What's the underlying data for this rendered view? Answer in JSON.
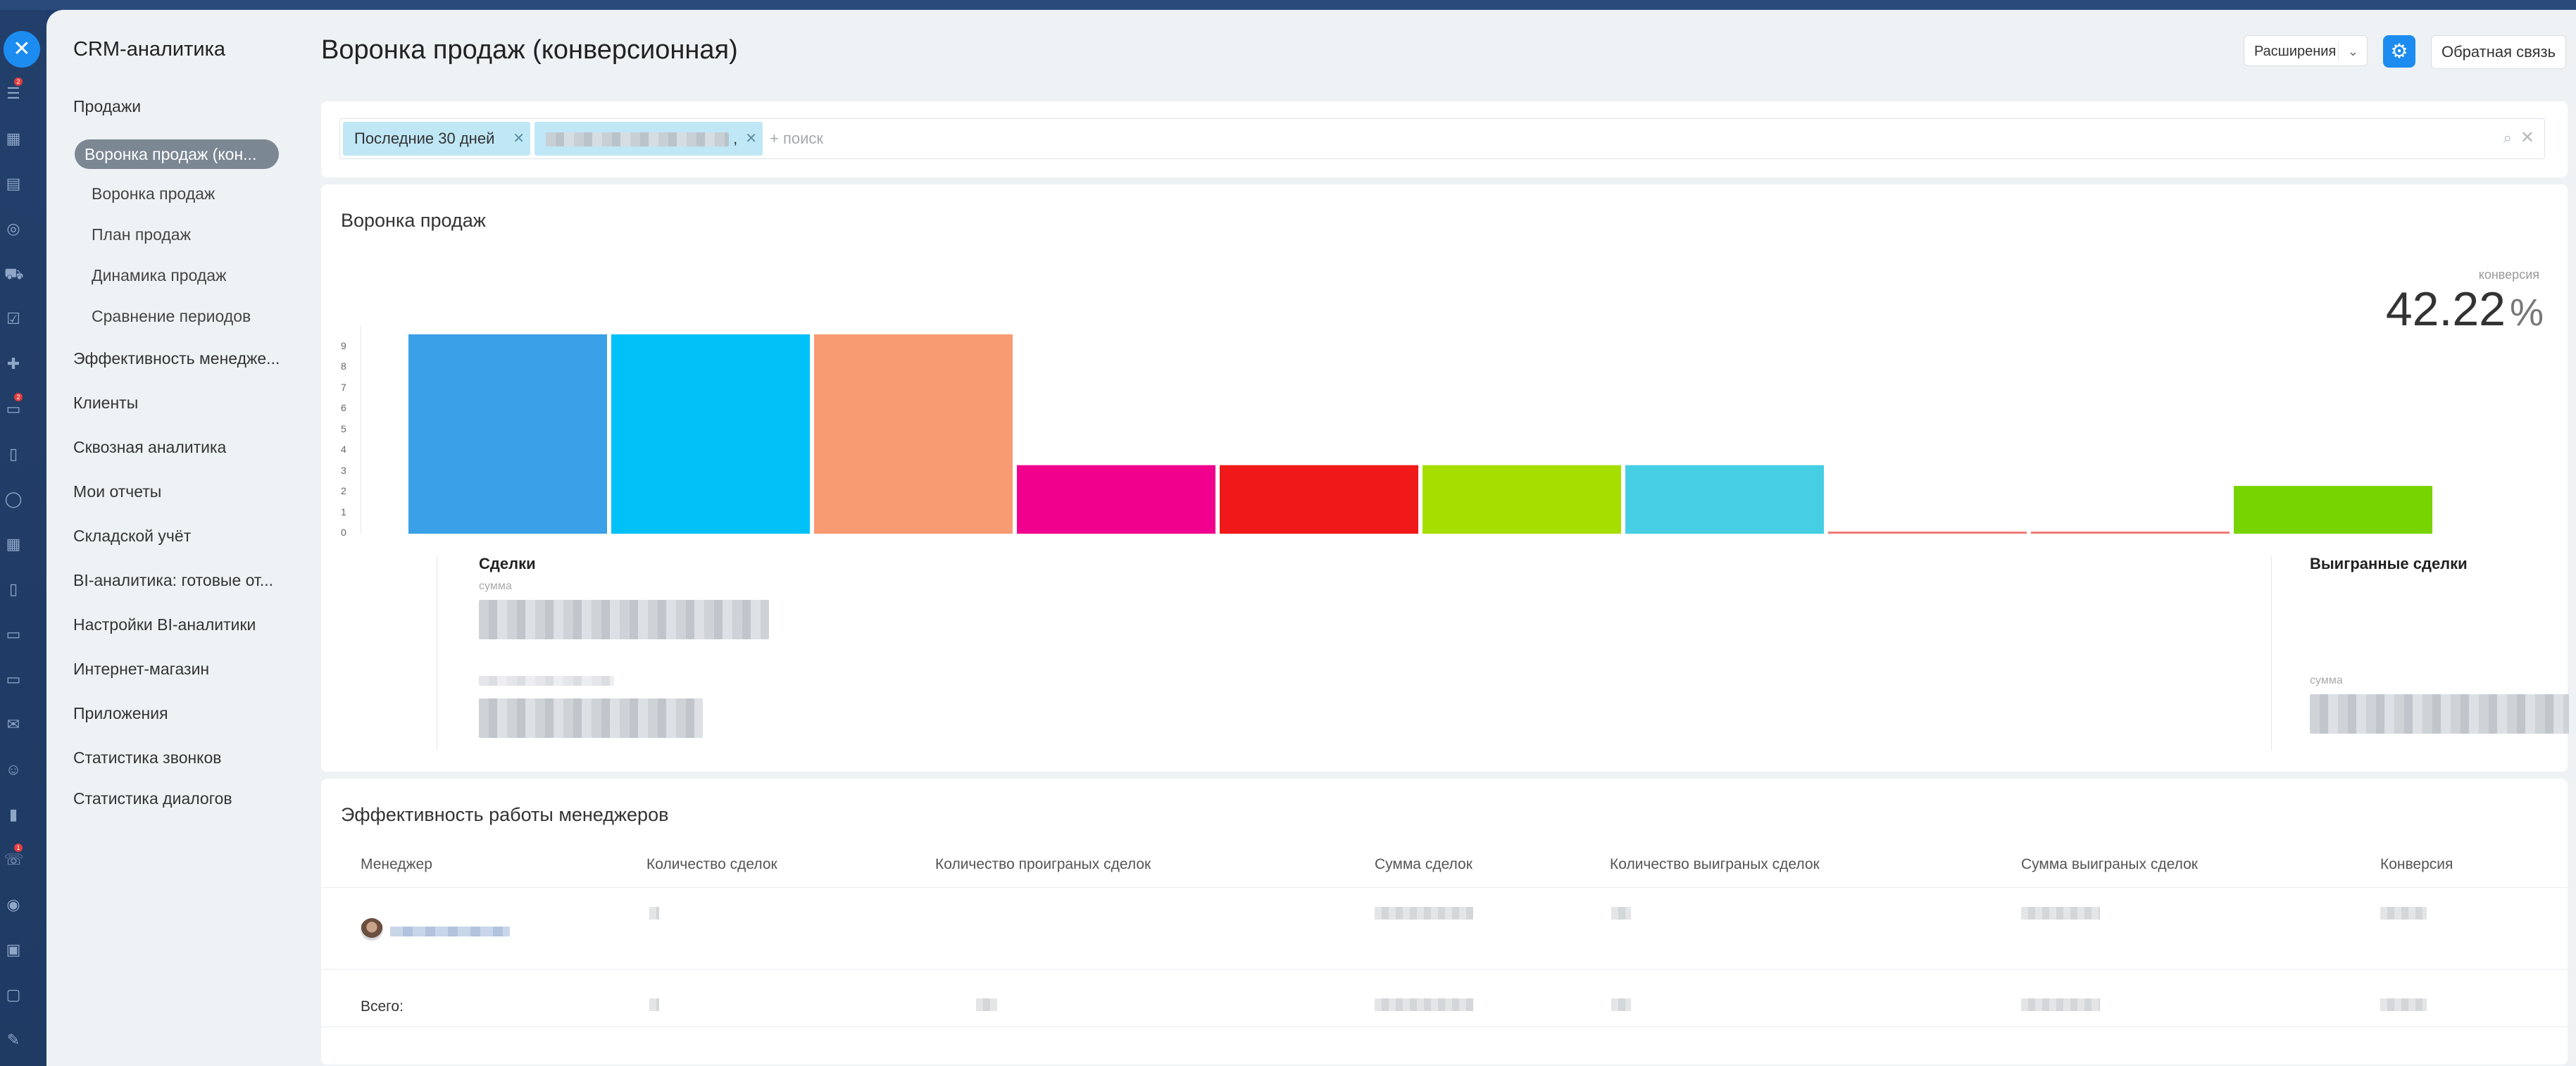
{
  "rail": {
    "icons": [
      "filter-icon",
      "calendar-icon",
      "inbox-icon",
      "target-icon",
      "cart-icon",
      "checklist-icon",
      "puzzle-icon",
      "chat-icon",
      "document-icon",
      "circle-icon",
      "calendar2-icon",
      "note-icon",
      "monitor-icon",
      "card-icon",
      "mail-icon",
      "contacts-icon",
      "analytics-icon",
      "telephony-icon",
      "robot-icon",
      "box-icon",
      "market-icon",
      "sign-icon"
    ],
    "badges": {
      "filter": "2",
      "chat": "2",
      "telephony": "1"
    }
  },
  "sidebar": {
    "title": "CRM-аналитика",
    "items": [
      {
        "label": "Продажи"
      },
      {
        "label": "Воронка продаж (кон...",
        "active": true
      },
      {
        "label": "Воронка продаж",
        "sub": true
      },
      {
        "label": "План продаж",
        "sub": true
      },
      {
        "label": "Динамика продаж",
        "sub": true
      },
      {
        "label": "Сравнение периодов",
        "sub": true
      },
      {
        "label": "Эффективность менедже..."
      },
      {
        "label": "Клиенты"
      },
      {
        "label": "Сквозная аналитика"
      },
      {
        "label": "Мои отчеты"
      },
      {
        "label": "Складской учёт"
      },
      {
        "label": "BI-аналитика: готовые от..."
      },
      {
        "label": "Настройки BI-аналитики"
      },
      {
        "label": "Интернет-магазин"
      },
      {
        "label": "Приложения"
      },
      {
        "label": "Статистика звонков"
      },
      {
        "label": "Статистика диалогов"
      }
    ]
  },
  "header": {
    "title": "Воронка продаж (конверсионная)",
    "extensions_label": "Расширения",
    "feedback_label": "Обратная связь"
  },
  "filter": {
    "chip_period": "Последние 30 дней",
    "chip_tail": ",",
    "placeholder": "+ поиск"
  },
  "funnel": {
    "title": "Воронка продаж",
    "conversion_label": "конверсия",
    "conversion_value": "42.22",
    "conversion_unit": "%",
    "deals_title": "Сделки",
    "deals_sum_label": "сумма",
    "won_title": "Выигранные сделки",
    "won_sum_label": "сумма"
  },
  "chart_data": {
    "type": "bar",
    "y_ticks": [
      "0",
      "1",
      "2",
      "3",
      "4",
      "5",
      "6",
      "7",
      "8",
      "9"
    ],
    "ylim": [
      0,
      9
    ],
    "values": [
      9.6,
      9.6,
      9.6,
      3.3,
      3.3,
      3.3,
      3.3,
      0.1,
      0.1,
      2.3
    ],
    "colors": [
      "#3aa0e8",
      "#00c0f8",
      "#f89a72",
      "#f0008c",
      "#f01818",
      "#a6de00",
      "#46cee4",
      "#f27a7a",
      "#f27a7a",
      "#78d400"
    ]
  },
  "managers": {
    "title": "Эффективность работы менеджеров",
    "columns": [
      "Менеджер",
      "Количество сделок",
      "Количество проиграных сделок",
      "Сумма сделок",
      "Количество выиграных сделок",
      "Сумма выиграных сделок",
      "Конверсия"
    ],
    "total_label": "Всего:"
  }
}
